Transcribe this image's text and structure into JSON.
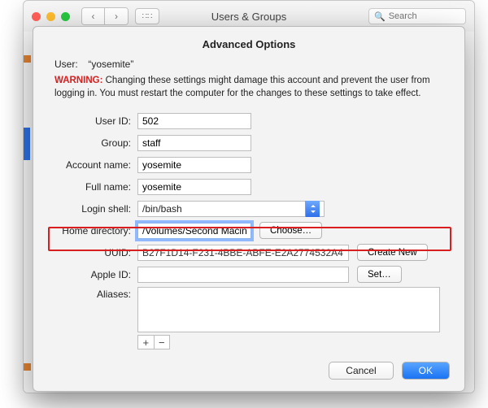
{
  "window": {
    "title": "Users & Groups",
    "search_placeholder": "Search"
  },
  "sheet": {
    "title": "Advanced Options",
    "user_label": "User:",
    "user_value": "“yosemite”",
    "warning_label": "WARNING:",
    "warning_text": " Changing these settings might damage this account and prevent the user from logging in. You must restart the computer for the changes to these settings to take effect."
  },
  "fields": {
    "user_id": {
      "label": "User ID:",
      "value": "502"
    },
    "group": {
      "label": "Group:",
      "value": "staff"
    },
    "account_name": {
      "label": "Account name:",
      "value": "yosemite"
    },
    "full_name": {
      "label": "Full name:",
      "value": "yosemite"
    },
    "login_shell": {
      "label": "Login shell:",
      "value": "/bin/bash"
    },
    "home_dir": {
      "label": "Home directory:",
      "value": "/Volumes/Second Macintosh HDD/yosemite",
      "button": "Choose…"
    },
    "uuid": {
      "label": "UUID:",
      "value": "B27F1D14-F231-4BBE-ABFE-E2A2774532A4",
      "button": "Create New"
    },
    "apple_id": {
      "label": "Apple ID:",
      "value": "",
      "button": "Set…"
    },
    "aliases": {
      "label": "Aliases:"
    }
  },
  "footer": {
    "cancel": "Cancel",
    "ok": "OK"
  }
}
